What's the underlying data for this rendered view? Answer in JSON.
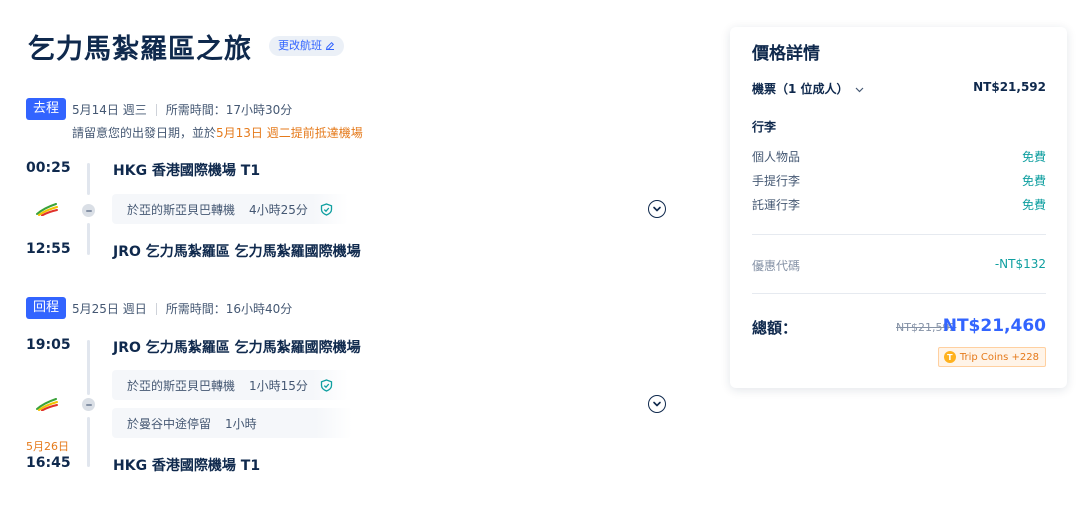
{
  "header": {
    "title": "乞力馬紮羅區之旅",
    "change_flight_label": "更改航班"
  },
  "outbound": {
    "badge": "去程",
    "date": "5月14日 週三",
    "duration": "所需時間：17小時30分",
    "notice_prefix": "請留意您的出發日期，並於",
    "notice_highlight": "5月13日 週二提前抵達機場",
    "depart_time": "00:25",
    "depart_airport": "HKG 香港國際機場 T1",
    "transfers": [
      {
        "place": "於亞的斯亞貝巴轉機",
        "duration": "4小時25分"
      }
    ],
    "arrive_time": "12:55",
    "arrive_airport": "JRO 乞力馬紮羅區 乞力馬紮羅國際機場"
  },
  "return": {
    "badge": "回程",
    "date": "5月25日 週日",
    "duration": "所需時間：16小時40分",
    "depart_time": "19:05",
    "depart_airport": "JRO 乞力馬紮羅區 乞力馬紮羅國際機場",
    "transfers": [
      {
        "place": "於亞的斯亞貝巴轉機",
        "duration": "1小時15分"
      },
      {
        "place": "於曼谷中途停留",
        "duration": "1小時"
      }
    ],
    "arrive_day": "5月26日",
    "arrive_time": "16:45",
    "arrive_airport": "HKG 香港國際機場 T1"
  },
  "price": {
    "title": "價格詳情",
    "ticket_label": "機票（1 位成人）",
    "ticket_amount": "NT$21,592",
    "baggage_heading": "行李",
    "baggage": [
      {
        "label": "個人物品",
        "value": "免費"
      },
      {
        "label": "手提行李",
        "value": "免費"
      },
      {
        "label": "託運行李",
        "value": "免費"
      }
    ],
    "coupon_label": "優惠代碼",
    "coupon_amount": "-NT$132",
    "total_label": "總額：",
    "original_total": "NT$21,592",
    "total": "NT$21,460",
    "coins": "Trip Coins +228",
    "coin_icon_letter": "T"
  },
  "colors": {
    "accent": "#3264ff",
    "free": "#0f9fa0",
    "highlight": "#e57a1b",
    "text": "#0f294d"
  }
}
